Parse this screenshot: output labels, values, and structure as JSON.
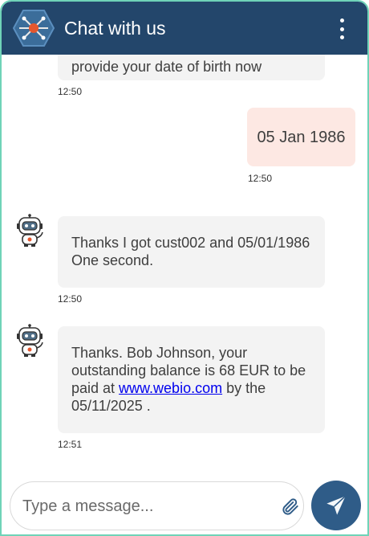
{
  "header": {
    "title": "Chat with us"
  },
  "messages": [
    {
      "sender": "bot",
      "text": "provide your date of birth now",
      "time": "12:50"
    },
    {
      "sender": "user",
      "text": "05 Jan 1986",
      "time": "12:50"
    },
    {
      "sender": "bot",
      "text": "Thanks I got cust002 and 05/01/1986 One second.",
      "time": "12:50"
    },
    {
      "sender": "bot",
      "text_before": "Thanks. Bob Johnson, your outstanding balance is 68 EUR to be paid at ",
      "link_text": "www.webio.com",
      "text_after": " by the 05/11/2025 .",
      "time": "12:51"
    }
  ],
  "composer": {
    "placeholder": "Type a message..."
  },
  "colors": {
    "header": "#23466b",
    "send_button": "#2f5c88",
    "user_bubble": "#fde8e3",
    "bot_bubble": "#f3f3f3",
    "frame_border": "#6fd3b8"
  },
  "icons": {
    "logo": "network-hexagon-icon",
    "menu": "kebab-menu-icon",
    "bot": "robot-avatar-icon",
    "attach": "paperclip-icon",
    "send": "paper-plane-icon"
  }
}
